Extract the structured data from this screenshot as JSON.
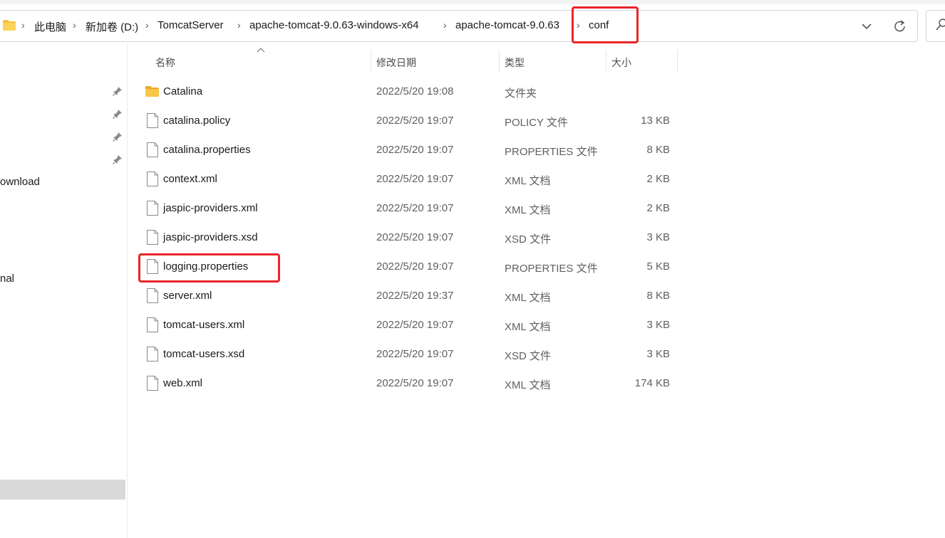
{
  "address": {
    "crumbs": [
      "此电脑",
      "新加卷 (D:)",
      "TomcatServer",
      "apache-tomcat-9.0.63-windows-x64",
      "apache-tomcat-9.0.63",
      "conf"
    ],
    "icons": {
      "folder": "folder-icon",
      "dropdown": "chevron-down-icon",
      "refresh": "refresh-icon",
      "search": "search-icon"
    }
  },
  "nav": {
    "items": [
      "ownload",
      "nal"
    ],
    "pins": [
      "pin-icon",
      "pin-icon",
      "pin-icon",
      "pin-icon"
    ]
  },
  "columns": {
    "name": "名称",
    "date": "修改日期",
    "type": "类型",
    "size": "大小"
  },
  "files": [
    {
      "name": "Catalina",
      "date": "2022/5/20 19:08",
      "type": "文件夹",
      "size": "",
      "icon": "folder-icon"
    },
    {
      "name": "catalina.policy",
      "date": "2022/5/20 19:07",
      "type": "POLICY 文件",
      "size": "13 KB",
      "icon": "file-icon"
    },
    {
      "name": "catalina.properties",
      "date": "2022/5/20 19:07",
      "type": "PROPERTIES 文件",
      "size": "8 KB",
      "icon": "file-icon"
    },
    {
      "name": "context.xml",
      "date": "2022/5/20 19:07",
      "type": "XML 文档",
      "size": "2 KB",
      "icon": "file-icon"
    },
    {
      "name": "jaspic-providers.xml",
      "date": "2022/5/20 19:07",
      "type": "XML 文档",
      "size": "2 KB",
      "icon": "file-icon"
    },
    {
      "name": "jaspic-providers.xsd",
      "date": "2022/5/20 19:07",
      "type": "XSD 文件",
      "size": "3 KB",
      "icon": "file-icon"
    },
    {
      "name": "logging.properties",
      "date": "2022/5/20 19:07",
      "type": "PROPERTIES 文件",
      "size": "5 KB",
      "icon": "file-icon"
    },
    {
      "name": "server.xml",
      "date": "2022/5/20 19:37",
      "type": "XML 文档",
      "size": "8 KB",
      "icon": "file-icon"
    },
    {
      "name": "tomcat-users.xml",
      "date": "2022/5/20 19:07",
      "type": "XML 文档",
      "size": "3 KB",
      "icon": "file-icon"
    },
    {
      "name": "tomcat-users.xsd",
      "date": "2022/5/20 19:07",
      "type": "XSD 文件",
      "size": "3 KB",
      "icon": "file-icon"
    },
    {
      "name": "web.xml",
      "date": "2022/5/20 19:07",
      "type": "XML 文档",
      "size": "174 KB",
      "icon": "file-icon"
    }
  ],
  "colors": {
    "highlight": "#e8252a",
    "folder": "#f5c13a",
    "selected": "#d9d9d9"
  }
}
